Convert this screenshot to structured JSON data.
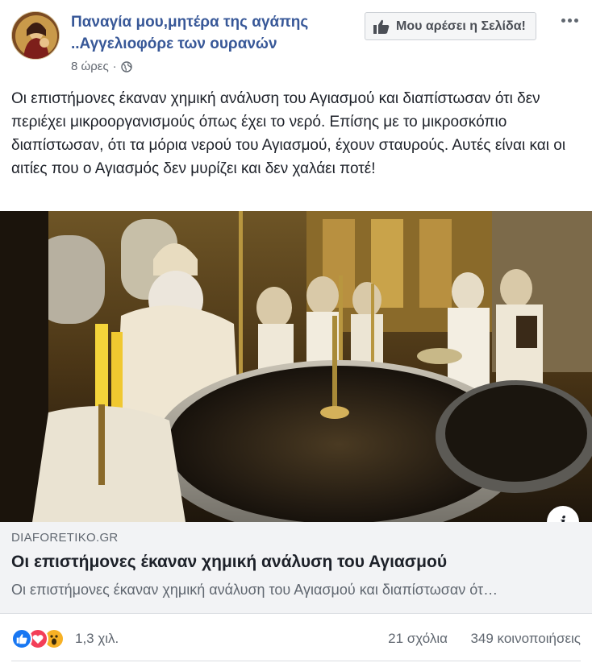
{
  "header": {
    "page_name": "Παναγία μου,μητέρα της αγάπης ..Αγγελιοφόρε των ουρανών",
    "timestamp": "8 ώρες",
    "separator": "·",
    "like_page_label": "Μου αρέσει η Σελίδα!"
  },
  "post": {
    "text": "Οι επιστήμονες έκαναν χημική ανάλυση του Αγιασμού και διαπίστωσαν ότι δεν περιέχει μικροοργανισμούς όπως έχει το νερό. Επίσης με το μικροσκόπιο διαπίστωσαν, ότι τα μόρια νερού του Αγιασμού, έχουν σταυρούς. Αυτές είναι και οι αιτίες που ο Αγιασμός δεν μυρίζει και δεν χαλάει ποτέ!"
  },
  "link_preview": {
    "domain": "DIAFORETIKO.GR",
    "title": "Οι επιστήμονες έκαναν χημική ανάλυση του Αγιασμού",
    "description": "Οι επιστήμονες έκαναν χημική ανάλυση του Αγιασμού και διαπίστωσαν ότ…"
  },
  "engagement": {
    "reactions_count": "1,3 χιλ.",
    "comments": "21 σχόλια",
    "shares": "349 κοινοποιήσεις",
    "reactions": [
      "like",
      "love",
      "wow"
    ]
  },
  "icons": {
    "avatar": "avatar-icon",
    "globe": "globe-icon",
    "thumb": "thumbs-up-icon",
    "more": "more-options-icon",
    "info": "info-icon"
  },
  "colors": {
    "link_blue": "#385898",
    "like_blue": "#1877f2",
    "love_red": "#f33e58",
    "wow_yellow": "#f7b125"
  }
}
